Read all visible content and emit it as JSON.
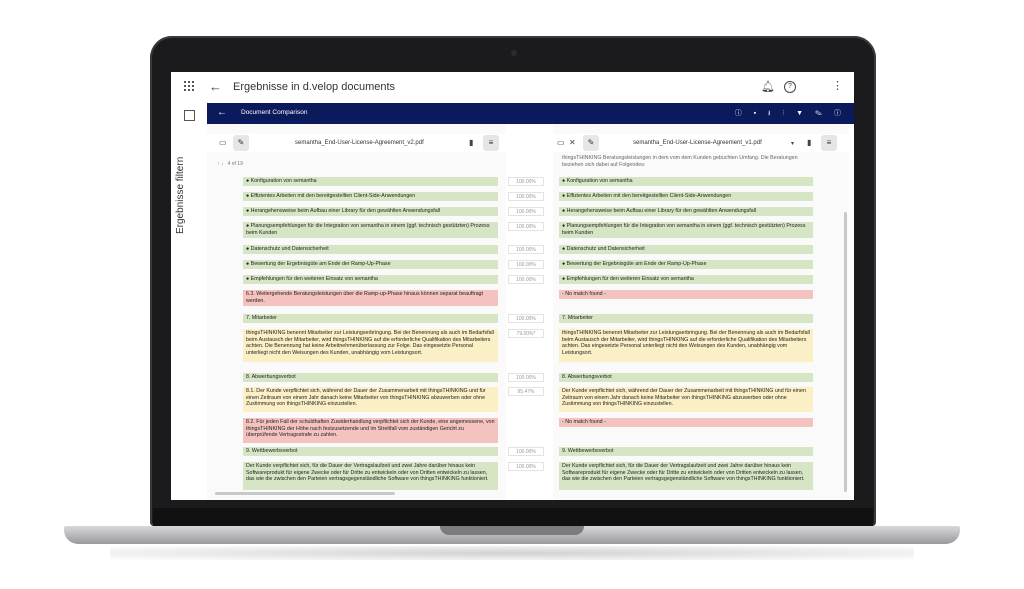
{
  "app": {
    "title": "Ergebnisse in d.velop documents",
    "filter_label": "Ergebnisse filtern"
  },
  "comparison": {
    "title": "Document Comparison",
    "left_file": "semantha_End-User-License-Agreement_v2.pdf",
    "right_file": "semantha_End-User-License-Agreement_v1.pdf",
    "pager": "4 of 19",
    "right_top_text": "thingsTHINKING Beratungsleistungen in dem vom dem Kunden gebuchten Umfang. Die Beratungen beziehen sich dabei auf Folgendes:"
  },
  "rows": [
    {
      "left": "● Konfiguration von semantha",
      "pct": "100.00%",
      "right": "● Konfiguration von semantha",
      "color": "green"
    },
    {
      "left": "● Effizientes Arbeiten mit den bereitgestellten Client-Side-Anwendungen",
      "pct": "100.00%",
      "right": "● Effizientes Arbeiten mit den bereitgestellten Client-Side-Anwendungen",
      "color": "green"
    },
    {
      "left": "● Herangehensweise beim Aufbau einer Library für den gewählten Anwendungsfall",
      "pct": "100.00%",
      "right": "● Herangehensweise beim Aufbau einer Library für den gewählten Anwendungsfall",
      "color": "green"
    },
    {
      "left": "● Planungsempfehlungen für die Integration von semantha in einem (ggf. technisch gestützten) Prozess beim Kunden",
      "pct": "100.00%",
      "right": "● Planungsempfehlungen für die Integration von semantha in einem (ggf. technisch gestützten) Prozess beim Kunden",
      "color": "green"
    },
    {
      "left": "● Datenschutz und Datensicherheit",
      "pct": "100.00%",
      "right": "● Datenschutz und Datensicherheit",
      "color": "green"
    },
    {
      "left": "● Bewertung der Ergebnisgüte am Ende der Ramp-Up-Phase",
      "pct": "100.00%",
      "right": "● Bewertung der Ergebnisgüte am Ende der Ramp-Up-Phase",
      "color": "green"
    },
    {
      "left": "● Empfehlungen für den weiteren Einsatz von semantha",
      "pct": "100.00%",
      "right": "● Empfehlungen für den weiteren Einsatz von semantha",
      "color": "green"
    },
    {
      "left": "6.3. Weitergehende Beratungsleistungen über die Ramp-up-Phase hinaus können separat beauftragt werden.",
      "pct": "",
      "right": "- No match found -",
      "color": "red"
    },
    {
      "left": "7. Mitarbeiter",
      "pct": "100.00%",
      "right": "7. Mitarbeiter",
      "color": "green"
    },
    {
      "left": "thingsTHINKING benennt Mitarbeiter zur Leistungserbringung. Bei der Benennung als auch im Bedarfsfall beim Austausch der Mitarbeiter, wird thingsTHINKING auf die erforderliche Qualifikation des Mitarbeiters achten. Die Benennung hat keine Arbeitnehmerüberlassung zur Folge. Das eingesetzte Personal unterliegt nicht den Weisungen des Kunden, unabhängig vom Leistungsort.",
      "pct": "79.00%*",
      "right": "thingsTHINKING benennt Mitarbeiter zur Leistungserbringung. Bei der Benennung als auch im Bedarfsfall beim Austausch der Mitarbeiter, wird thingsTHINKING auf die erforderliche Qualifikation des Mitarbeiters achten. Das eingesetzte Personal unterliegt nicht den Weisungen des Kunden, unabhängig vom Leistungsort.",
      "color": "yellow"
    },
    {
      "left": "8. Abwerbungsverbot",
      "pct": "100.00%",
      "right": "8. Abwerbungsverbot",
      "color": "green"
    },
    {
      "left": "8.1. Der Kunde verpflichtet sich, während der Dauer der Zusammenarbeit mit thingsTHINKING und für einen Zeitraum von einem Jahr danach keine Mitarbeiter von thingsTHINKING abzuwerben oder ohne Zustimmung von thingsTHINKING einzustellen.",
      "pct": "95.47%",
      "right": "Der Kunde verpflichtet sich, während der Dauer der Zusammenarbeit mit thingsTHINKING und für einen Zeitraum von einem Jahr danach keine Mitarbeiter von thingsTHINKING abzuwerben oder ohne Zustimmung von thingsTHINKING einzustellen.",
      "color": "yellow"
    },
    {
      "left": "8.2. Für jeden Fall der schuldhaften Zuwiderhandlung verpflichtet sich der Kunde, eine angemessene, von thingsTHINKING der Höhe nach festzusetzende und im Streitfall vom zuständigen Gericht zu überprüfende Vertragsstrafe zu zahlen.",
      "pct": "",
      "right": "- No match found -",
      "color": "red"
    },
    {
      "left": "9. Wettbewerbsverbot",
      "pct": "100.00%",
      "right": "9. Wettbewerbsverbot",
      "color": "green"
    },
    {
      "left": "Der Kunde verpflichtet sich, für die Dauer der Vertragslaufzeit und zwei Jahre darüber hinaus kein Softwareprodukt für eigene Zwecke oder für Dritte zu entwickeln oder von Dritten entwickeln zu lassen, das wie die zwischen den Parteien vertragsgegenständliche Software von thingsTHINKING funktioniert.",
      "pct": "100.00%",
      "right": "Der Kunde verpflichtet sich, für die Dauer der Vertragslaufzeit und zwei Jahre darüber hinaus kein Softwareprodukt für eigene Zwecke oder für Dritte zu entwickeln oder von Dritten entwickeln zu lassen, das wie die zwischen den Parteien vertragsgegenständliche Software von thingsTHINKING funktioniert.",
      "color": "green"
    }
  ],
  "icons": {
    "apps": "apps-grid-icon",
    "back": "arrow-left-icon",
    "bell": "bell-icon",
    "help": "help-icon",
    "more": "more-vert-icon"
  }
}
